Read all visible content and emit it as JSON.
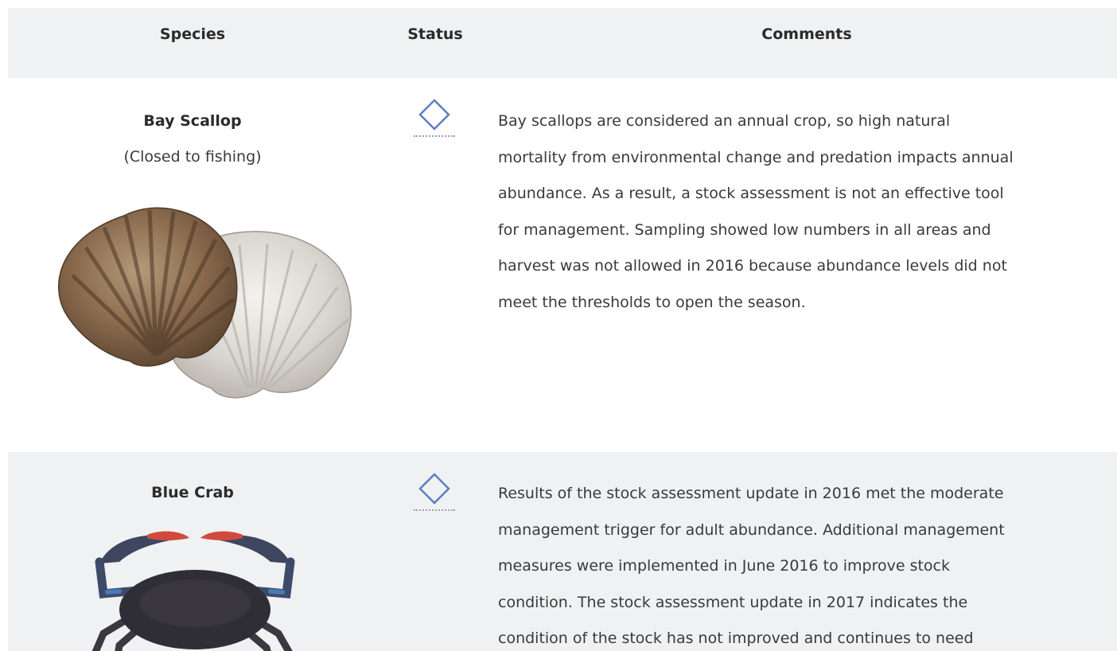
{
  "table": {
    "headers": {
      "species": "Species",
      "status": "Status",
      "comments": "Comments"
    },
    "rows": [
      {
        "species": "Bay Scallop",
        "note": "(Closed to fishing)",
        "status_icon": "diamond-outline-icon",
        "comment": "Bay scallops are considered an annual crop, so high natural\nmortality from environmental change and predation impacts annual\nabundance. As a result, a stock assessment is not an effective tool\nfor management. Sampling showed low numbers in all areas and\nharvest was not allowed in 2016 because abundance levels did not\nmeet the thresholds to open the season."
      },
      {
        "species": "Blue Crab",
        "status_icon": "diamond-outline-icon",
        "comment": "Results of the stock assessment update in 2016 met the moderate\nmanagement trigger for adult abundance. Additional management\nmeasures were implemented in June 2016 to improve stock\ncondition. The stock assessment update in 2017 indicates the\ncondition of the stock has not improved and continues to need"
      }
    ]
  },
  "colors": {
    "header_bg": "#f0f1f2",
    "alt_row_bg": "#f0f1f2",
    "status_icon": "#5b7fc4"
  }
}
